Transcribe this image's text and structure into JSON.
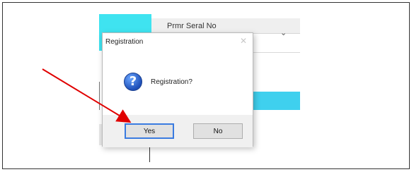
{
  "background": {
    "column_header": "Prmr Seral No",
    "dropdown_chevron": "⌄"
  },
  "dialog": {
    "title": "Registration",
    "close_symbol": "✕",
    "icon": "question-icon",
    "icon_glyph": "?",
    "message": "Registration?",
    "buttons": {
      "yes": "Yes",
      "no": "No"
    }
  },
  "colors": {
    "highlight_cyan": "#3fe3f0",
    "selection_row": "#3fd0ee",
    "arrow_red": "#e00000",
    "focus_blue": "#3a7be0"
  }
}
